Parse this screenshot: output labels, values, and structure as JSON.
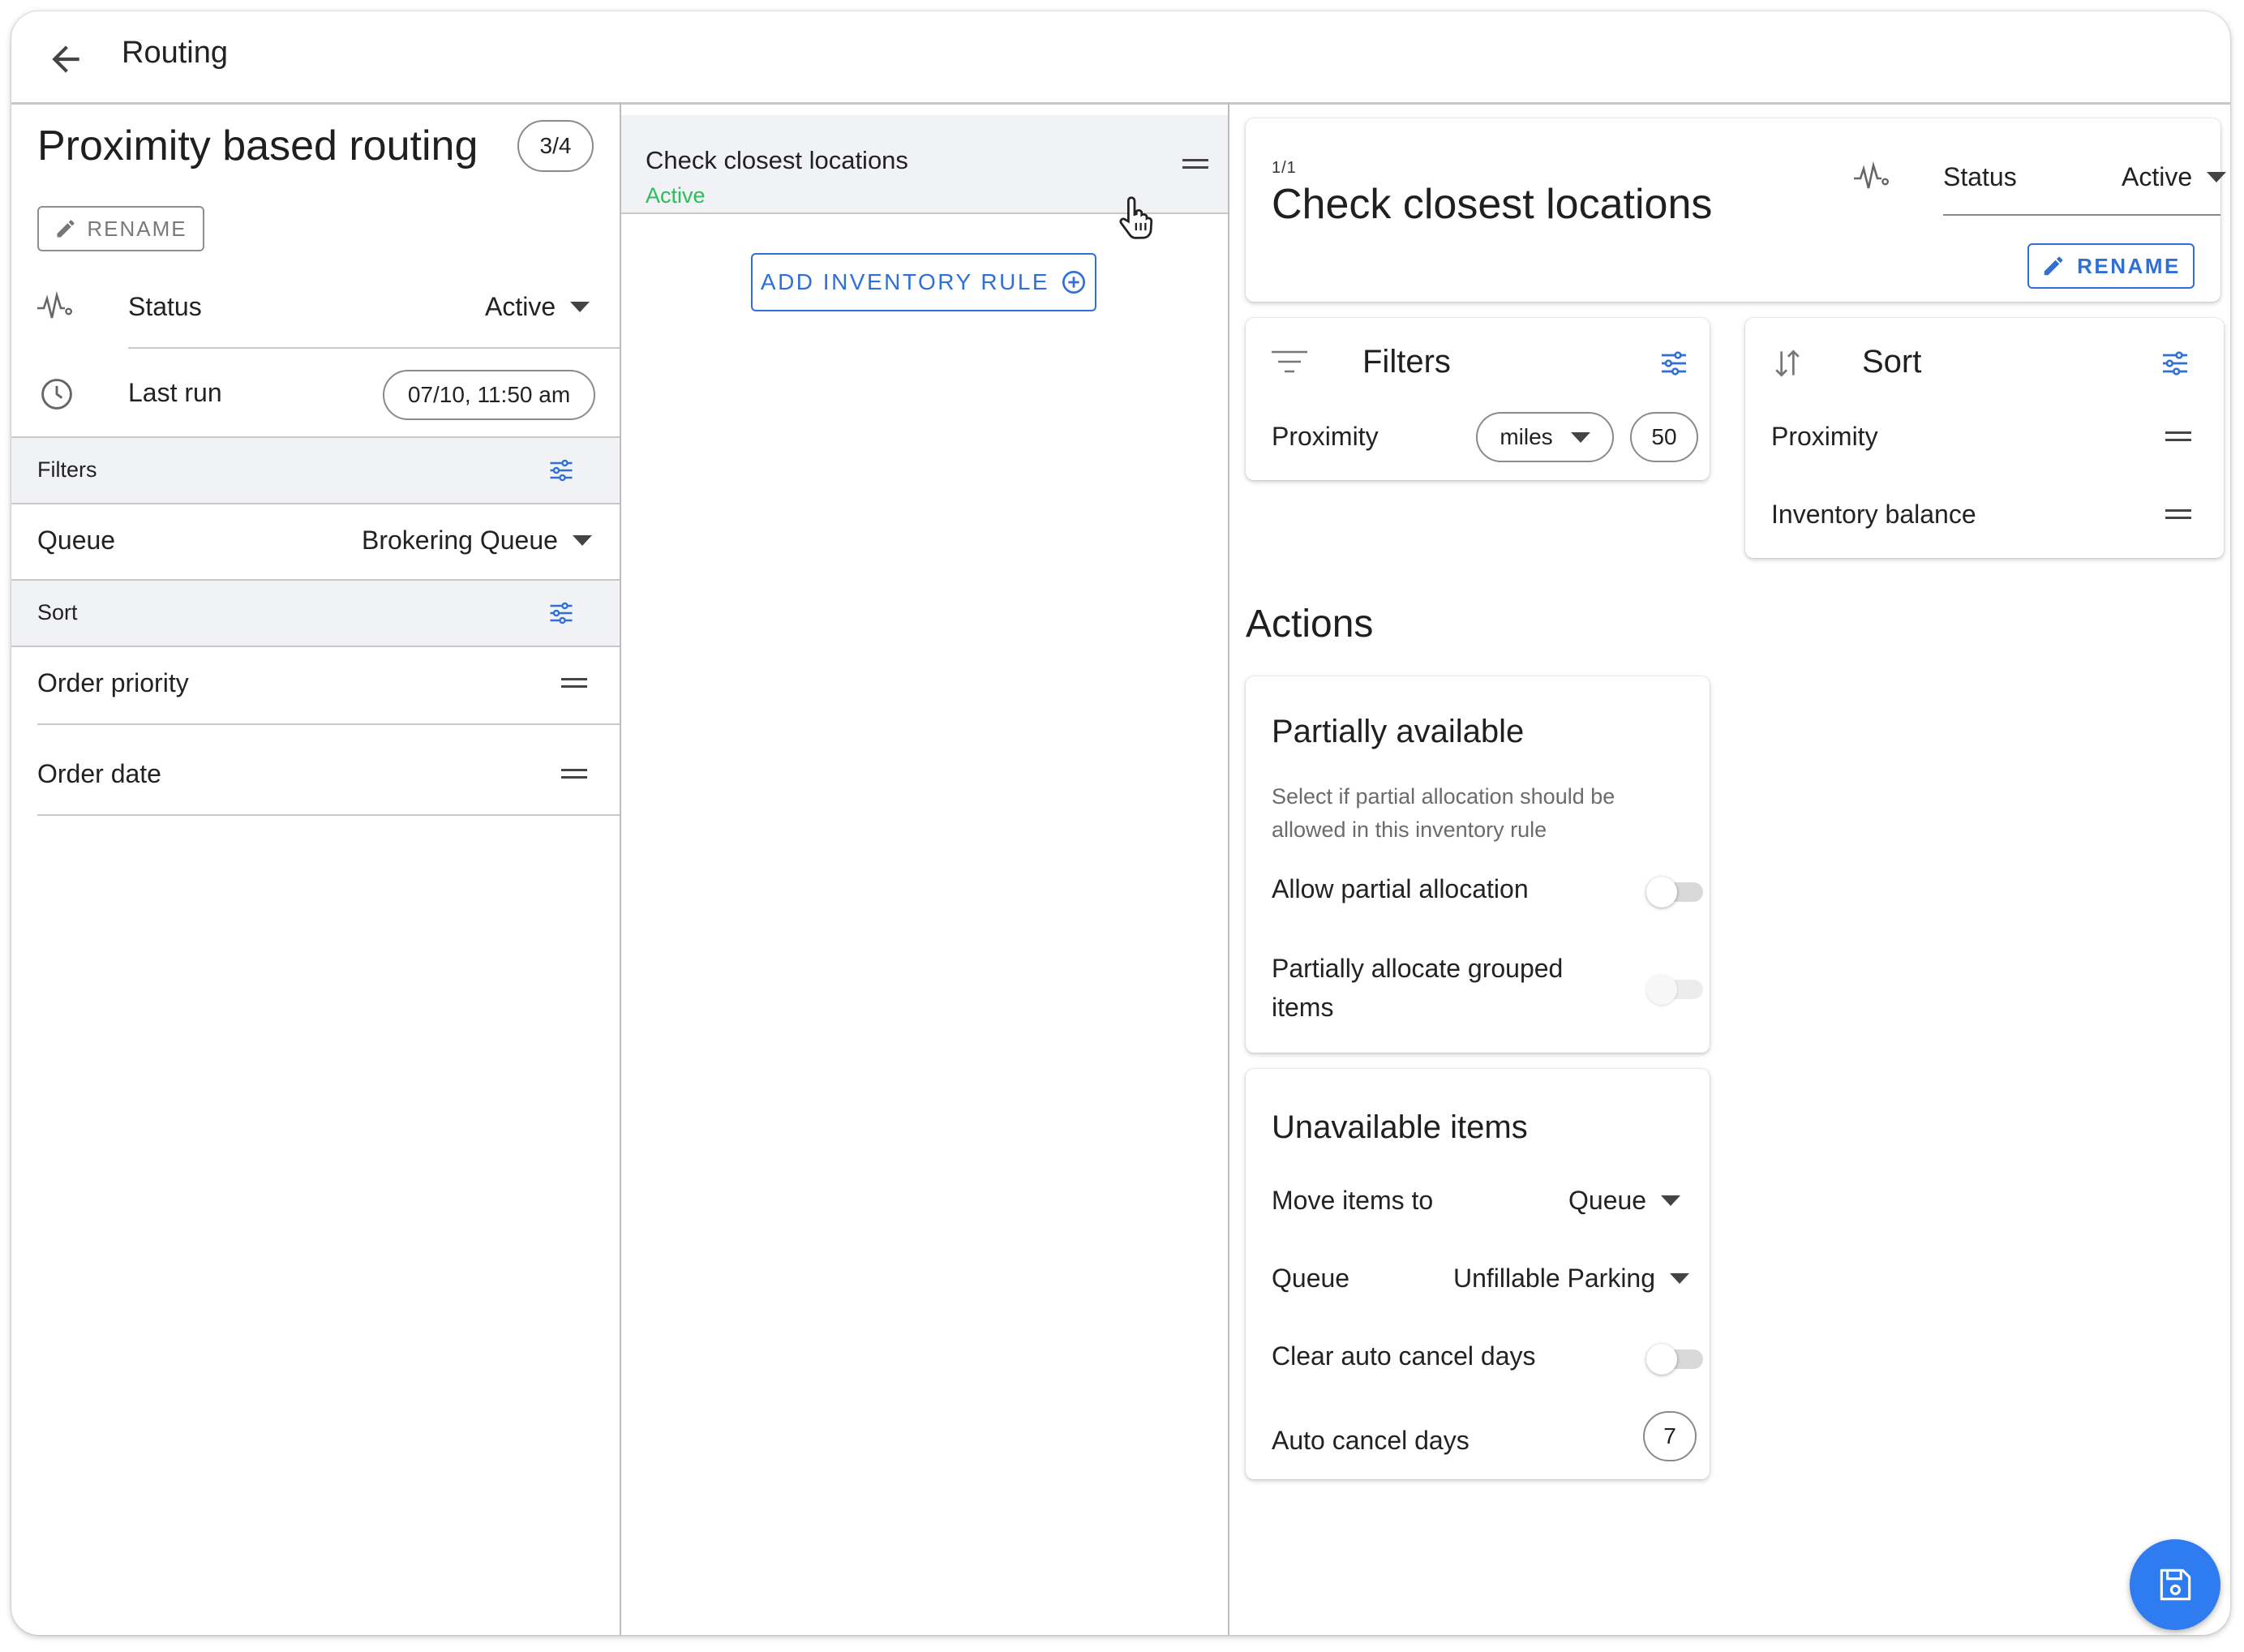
{
  "app": {
    "title": "Routing"
  },
  "routing": {
    "name": "Proximity based routing",
    "position": "3/4",
    "rename_label": "RENAME",
    "status_label": "Status",
    "status_value": "Active",
    "last_run_label": "Last run",
    "last_run_value": "07/10, 11:50 am",
    "filters_header": "Filters",
    "queue_label": "Queue",
    "queue_value": "Brokering Queue",
    "sort_header": "Sort",
    "sort_items": [
      "Order priority",
      "Order date"
    ]
  },
  "rules": {
    "items": [
      {
        "name": "Check closest locations",
        "status": "Active"
      }
    ],
    "add_label": "ADD INVENTORY RULE"
  },
  "rule_detail": {
    "position": "1/1",
    "title": "Check closest locations",
    "status_label": "Status",
    "status_value": "Active",
    "rename_label": "RENAME",
    "filters": {
      "title": "Filters",
      "proximity_label": "Proximity",
      "unit_value": "miles",
      "distance_value": "50"
    },
    "sort": {
      "title": "Sort",
      "items": [
        "Proximity",
        "Inventory balance"
      ]
    },
    "actions_title": "Actions",
    "partial": {
      "title": "Partially available",
      "description": "Select if partial allocation should be allowed in this inventory rule",
      "allow_label": "Allow partial allocation",
      "allow_on": false,
      "grouped_label": "Partially allocate grouped items",
      "grouped_on": false
    },
    "unavailable": {
      "title": "Unavailable items",
      "move_label": "Move items to",
      "move_value": "Queue",
      "queue_label": "Queue",
      "queue_value": "Unfillable Parking",
      "clear_label": "Clear auto cancel days",
      "clear_on": false,
      "cancel_days_label": "Auto cancel days",
      "cancel_days_value": "7"
    }
  },
  "colors": {
    "accent": "#2f6fd6",
    "active_green": "#2dbd5a",
    "fab": "#2f7bf0"
  },
  "icons": [
    "back-arrow-icon",
    "pulse-icon",
    "clock-icon",
    "tune-icon",
    "drag-handle-icon",
    "pencil-icon",
    "add-circle-icon",
    "filter-lines-icon",
    "sort-arrows-icon",
    "save-icon",
    "pointer-hand-icon"
  ]
}
